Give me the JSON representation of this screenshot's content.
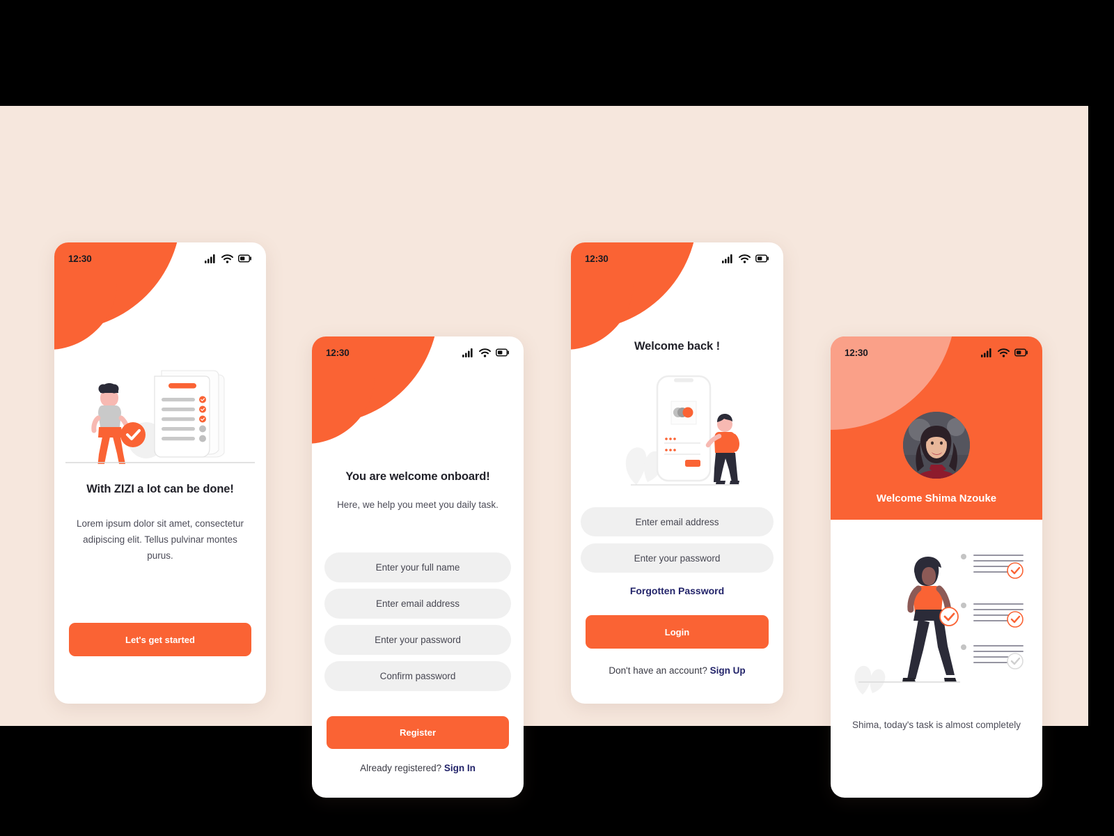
{
  "theme": {
    "accent": "#FA6334",
    "accent_light": "#FAA088",
    "navy": "#23246A",
    "canvas_bg": "#F6E7DD",
    "field_bg": "#F0F0F0",
    "frame_bg": "#000000"
  },
  "status_bar": {
    "time": "12:30",
    "icons": [
      "signal-icon",
      "wifi-icon",
      "battery-icon"
    ]
  },
  "screens": [
    {
      "id": "onboarding",
      "headline": "With ZIZI a lot can be done!",
      "body": "Lorem ipsum dolor sit amet, consectetur adipiscing elit. Tellus pulvinar montes purus.",
      "cta_label": "Let's get started",
      "illustration": "woman-with-checklist-illustration"
    },
    {
      "id": "register",
      "headline": "You are welcome onboard!",
      "subtext": "Here, we help you meet you daily task.",
      "fields": [
        {
          "name": "full-name-input",
          "placeholder": "Enter your full name"
        },
        {
          "name": "email-input",
          "placeholder": "Enter email address"
        },
        {
          "name": "password-input",
          "placeholder": "Enter your password"
        },
        {
          "name": "confirm-password-input",
          "placeholder": "Confirm password"
        }
      ],
      "cta_label": "Register",
      "footer_text": "Already registered? ",
      "footer_link": "Sign In"
    },
    {
      "id": "login",
      "headline": "Welcome back !",
      "illustration": "phone-login-illustration",
      "fields": [
        {
          "name": "email-input",
          "placeholder": "Enter email address"
        },
        {
          "name": "password-input",
          "placeholder": "Enter your password"
        }
      ],
      "forgot_label": "Forgotten Password",
      "cta_label": "Login",
      "footer_text": "Don't have an account? ",
      "footer_link": "Sign Up"
    },
    {
      "id": "home",
      "welcome": "Welcome Shima Nzouke",
      "avatar": "user-avatar-photo",
      "illustration": "woman-walking-tasklist-illustration",
      "summary": "Shima, today's task is almost completely",
      "tasks": [
        {
          "label": "task-group-1",
          "done": true
        },
        {
          "label": "task-group-2",
          "done": true
        },
        {
          "label": "task-group-3",
          "done": false
        }
      ]
    }
  ]
}
